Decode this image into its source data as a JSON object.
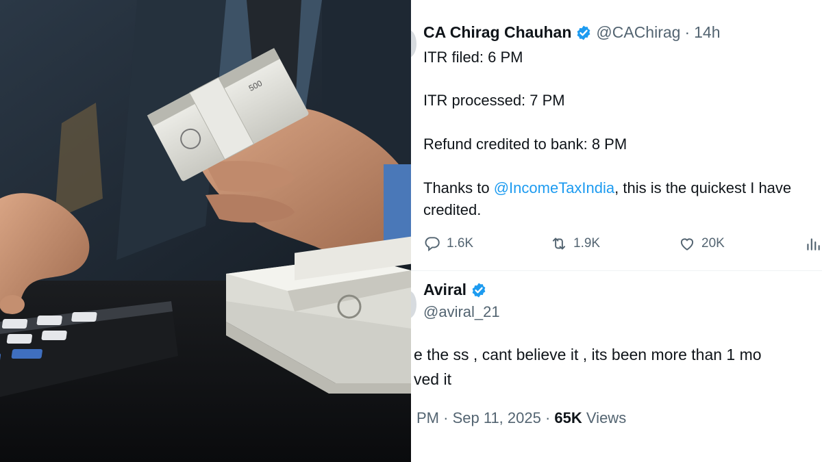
{
  "tweet": {
    "author_name": "CA Chirag Chauhan",
    "author_handle": "@CAChirag",
    "separator": "·",
    "time": "14h",
    "lines": [
      "ITR filed: 6 PM",
      "ITR processed: 7 PM",
      "Refund credited to bank: 8 PM"
    ],
    "thanks_prefix": "Thanks to ",
    "mention": "@IncomeTaxIndia",
    "thanks_suffix": ", this is the quickest I have",
    "last_line": "credited.",
    "actions": {
      "replies": "1.6K",
      "retweets": "1.9K",
      "likes": "20K"
    }
  },
  "quoted_tweet": {
    "author_name": "Aviral",
    "author_handle": "@aviral_21",
    "text_line1": "e the ss , cant believe it , its been more than 1 mo",
    "text_line2": "ved it",
    "time_partial": "PM",
    "separator": "·",
    "date": "Sep 11, 2025",
    "views_count": "65K",
    "views_label": "Views"
  },
  "colors": {
    "link": "#1d9bf0",
    "secondary_text": "#536471",
    "verified_badge": "#1d9bf0",
    "primary_text": "#0f1419"
  },
  "icons": {
    "verified": "verified-badge-icon",
    "reply": "reply-icon",
    "retweet": "retweet-icon",
    "like": "heart-icon",
    "views": "analytics-icon"
  }
}
